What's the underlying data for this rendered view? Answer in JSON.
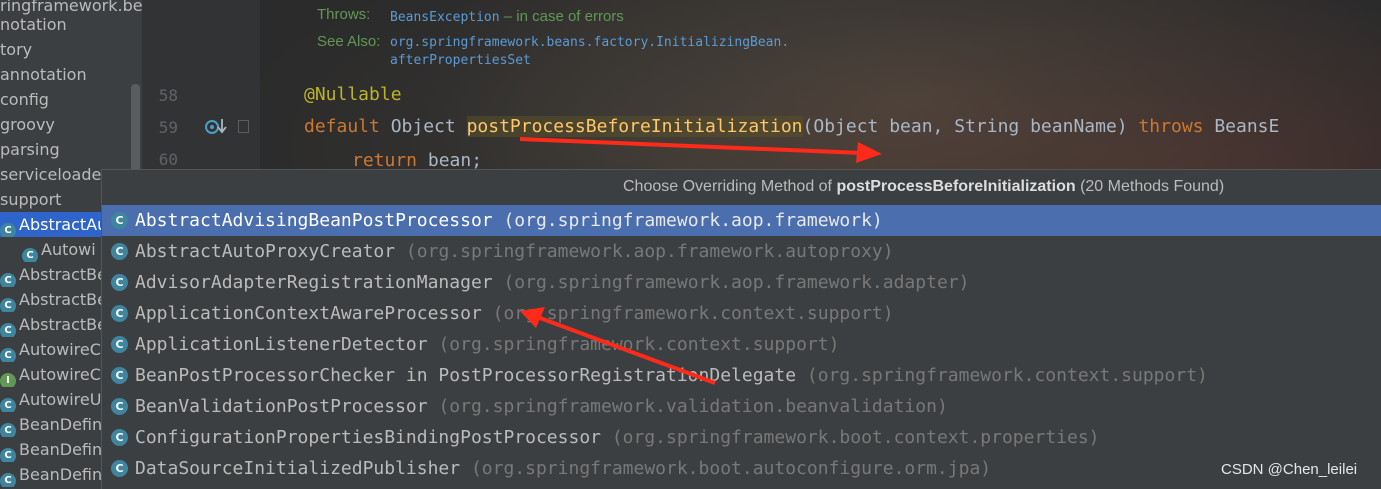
{
  "tree": {
    "items": [
      {
        "label": "ringframework.bea",
        "icon": ""
      },
      {
        "label": "notation",
        "icon": ""
      },
      {
        "label": "tory",
        "icon": ""
      },
      {
        "label": "annotation",
        "icon": ""
      },
      {
        "label": "config",
        "icon": ""
      },
      {
        "label": "groovy",
        "icon": ""
      },
      {
        "label": "parsing",
        "icon": ""
      },
      {
        "label": "serviceloader",
        "icon": ""
      },
      {
        "label": "support",
        "icon": ""
      },
      {
        "label": "AbstractAu",
        "icon": "C"
      },
      {
        "label": "Autowi",
        "icon": "C"
      },
      {
        "label": "AbstractBe",
        "icon": "C"
      },
      {
        "label": "AbstractBe",
        "icon": "C"
      },
      {
        "label": "AbstractBe",
        "icon": "C"
      },
      {
        "label": "AutowireC",
        "icon": "C"
      },
      {
        "label": "AutowireC",
        "icon": "I"
      },
      {
        "label": "AutowireU",
        "icon": "C"
      },
      {
        "label": "BeanDefin",
        "icon": "C"
      },
      {
        "label": "BeanDefin",
        "icon": "C"
      },
      {
        "label": "BeanDefin",
        "icon": "C"
      }
    ]
  },
  "doc": {
    "throws_label": "Throws:",
    "throws_value": "BeansException",
    "throws_text": " – in case of errors",
    "see_also_label": "See Also:",
    "see_also_line1": "org.springframework.beans.factory.InitializingBean.",
    "see_also_line2": "afterPropertiesSet"
  },
  "code": {
    "line58": {
      "num": "58",
      "annotation": "@Nullable"
    },
    "line59": {
      "num": "59",
      "keyword": "default",
      "type": " Object ",
      "method": "postProcessBeforeInitialization",
      "params": "(Object bean, String beanName) ",
      "throws_kw": "throws",
      "exception": " BeansE"
    },
    "line60": {
      "num": "60",
      "keyword": "return",
      "rest": " bean;"
    }
  },
  "popup": {
    "title_prefix": "Choose Overriding Method of ",
    "title_method": "postProcessBeforeInitialization",
    "title_suffix": " (20 Methods Found)",
    "items": [
      {
        "name": "AbstractAdvisingBeanPostProcessor",
        "pkg": " (org.springframework.aop.framework)",
        "selected": true
      },
      {
        "name": "AbstractAutoProxyCreator",
        "pkg": " (org.springframework.aop.framework.autoproxy)"
      },
      {
        "name": "AdvisorAdapterRegistrationManager",
        "pkg": " (org.springframework.aop.framework.adapter)"
      },
      {
        "name": "ApplicationContextAwareProcessor",
        "pkg": " (org.springframework.context.support)"
      },
      {
        "name": "ApplicationListenerDetector",
        "pkg": " (org.springframework.context.support)"
      },
      {
        "name": "BeanPostProcessorChecker in PostProcessorRegistrationDelegate",
        "pkg": " (org.springframework.context.support)"
      },
      {
        "name": "BeanValidationPostProcessor",
        "pkg": " (org.springframework.validation.beanvalidation)"
      },
      {
        "name": "ConfigurationPropertiesBindingPostProcessor",
        "pkg": " (org.springframework.boot.context.properties)"
      },
      {
        "name": "DataSourceInitializedPublisher",
        "pkg": " (org.springframework.boot.autoconfigure.orm.jpa)"
      }
    ],
    "class_icon": "C"
  },
  "colors": {
    "selection": "#4b6eaf",
    "arrow": "#ff2a1a",
    "keyword": "#cc7832",
    "method": "#ffc66d"
  },
  "watermark": "CSDN @Chen_leilei"
}
